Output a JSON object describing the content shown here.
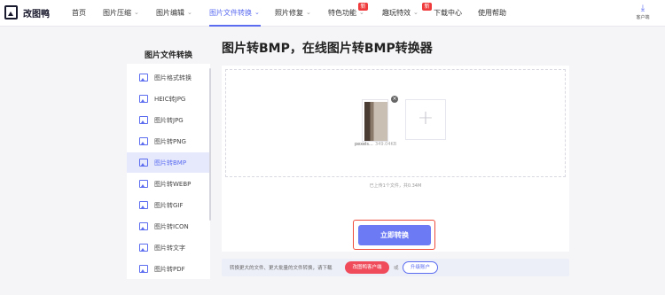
{
  "brand": {
    "name": "改图鸭"
  },
  "nav": {
    "items": [
      {
        "label": "首页"
      },
      {
        "label": "图片压缩"
      },
      {
        "label": "图片编辑"
      },
      {
        "label": "图片文件转换"
      },
      {
        "label": "照片修复"
      },
      {
        "label": "特色功能"
      },
      {
        "label": "趣玩特效"
      },
      {
        "label": "下载中心"
      },
      {
        "label": "使用帮助"
      }
    ],
    "badge_new": "新",
    "active": "图片文件转换"
  },
  "client": {
    "label": "客户端"
  },
  "headline": "图片转BMP，在线图片转BMP转换器",
  "sidebar": {
    "title": "图片文件转换",
    "items": [
      {
        "label": "图片格式转换"
      },
      {
        "label": "HEIC转JPG"
      },
      {
        "label": "图片转JPG"
      },
      {
        "label": "图片转PNG"
      },
      {
        "label": "图片转BMP"
      },
      {
        "label": "图片转WEBP"
      },
      {
        "label": "图片转GIF"
      },
      {
        "label": "图片转ICON"
      },
      {
        "label": "图片转文字"
      },
      {
        "label": "图片转PDF"
      }
    ],
    "active": "图片转BMP"
  },
  "upload": {
    "file_name": "pexels...",
    "file_size": "349.04KB",
    "add_symbol": "+",
    "close_symbol": "×",
    "info": "已上传1个文件，共0.34M"
  },
  "convert_button": "立即转换",
  "footer": {
    "text": "转换更大的文件、更大批量的文件转换，请下载",
    "download_button": "改图鸭客户端",
    "or": "或",
    "upgrade_button": "升级账户"
  },
  "colors": {
    "accent": "#5b6cf0",
    "danger": "#ef4b3b"
  }
}
